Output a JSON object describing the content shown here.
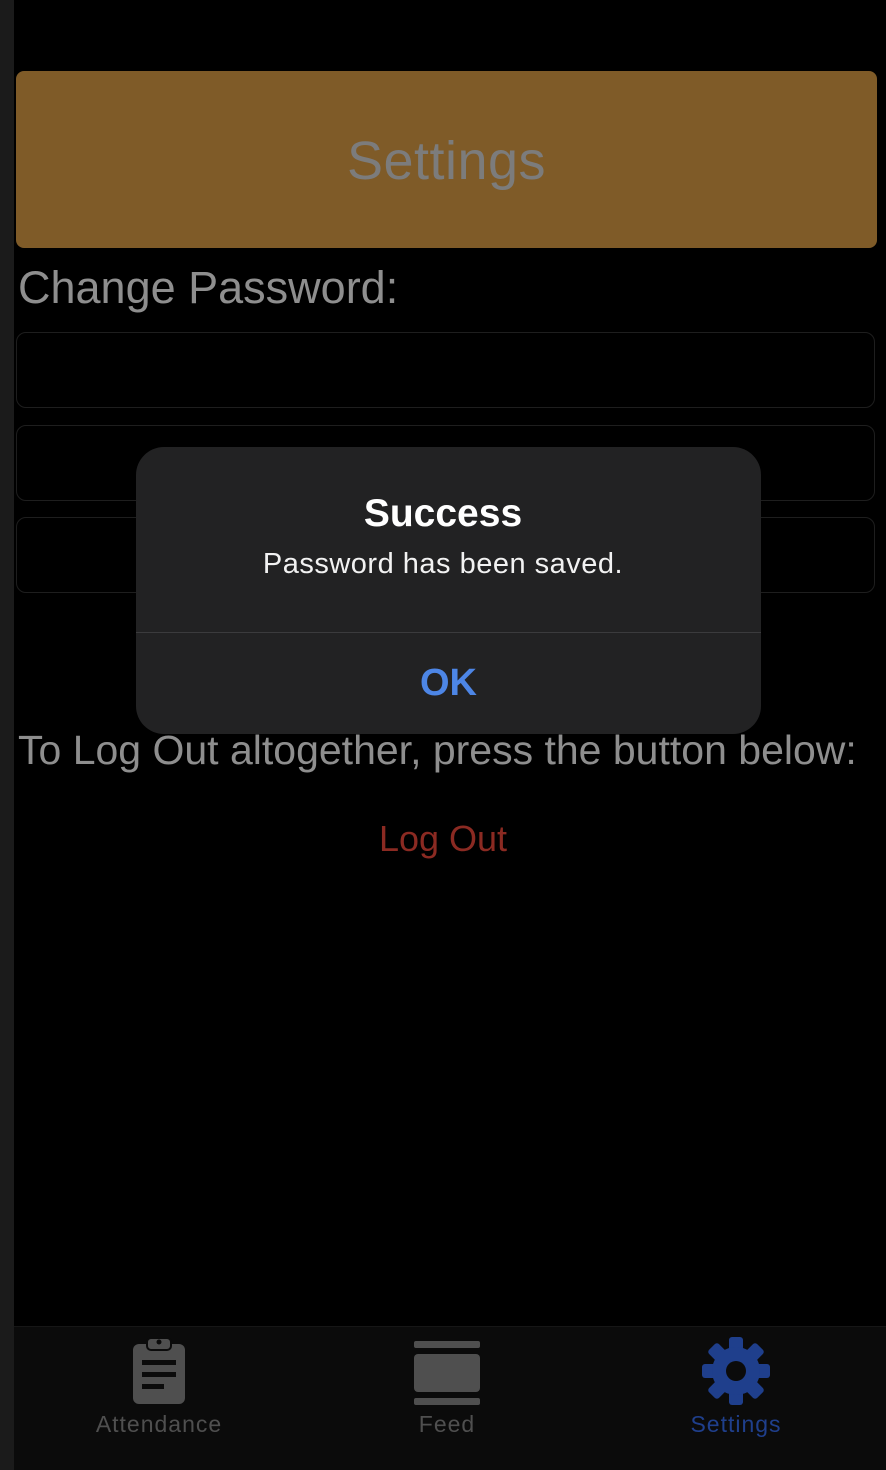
{
  "header": {
    "title": "Settings"
  },
  "password_section": {
    "label": "Change Password:",
    "fields": [
      {
        "value": "",
        "placeholder": ""
      },
      {
        "value": "",
        "placeholder": ""
      },
      {
        "value": "",
        "placeholder": ""
      }
    ]
  },
  "logout": {
    "instructions": "To Log Out altogether, press the button below:",
    "button_label": "Log Out",
    "color": "#8b2a22"
  },
  "alert": {
    "title": "Success",
    "message": "Password has been saved.",
    "ok_label": "OK",
    "ok_color": "#4d86e6"
  },
  "tab_bar": {
    "tabs": [
      {
        "label": "Attendance",
        "icon": "clipboard-icon",
        "active": false
      },
      {
        "label": "Feed",
        "icon": "feed-icon",
        "active": false
      },
      {
        "label": "Settings",
        "icon": "gear-icon",
        "active": true
      }
    ],
    "active_color": "#1f3f8c",
    "inactive_color": "#4f4f4f"
  },
  "colors": {
    "header_background": "#7f5b28",
    "background": "#000000"
  }
}
